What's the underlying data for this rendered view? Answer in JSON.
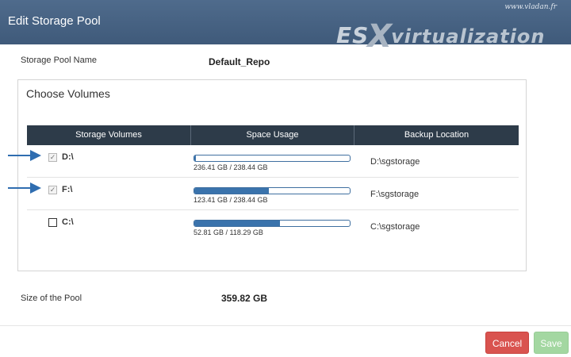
{
  "header": {
    "title": "Edit Storage Pool"
  },
  "logo": {
    "url": "www.vladan.fr",
    "part1": "ES",
    "part2": "X",
    "part3": "virtualization"
  },
  "pool": {
    "name_label": "Storage Pool Name",
    "name_value": "Default_Repo",
    "size_label": "Size of the Pool",
    "size_value": "359.82 GB"
  },
  "volumes": {
    "title": "Choose Volumes",
    "headers": [
      "Storage Volumes",
      "Space Usage",
      "Backup Location"
    ],
    "rows": [
      {
        "checked": true,
        "mark": "✓",
        "volume": "D:\\",
        "usage": "236.41 GB / 238.44 GB",
        "used_fraction": 0.01,
        "location": "D:\\sgstorage",
        "arrow": true
      },
      {
        "checked": true,
        "mark": "✓",
        "volume": "F:\\",
        "usage": "123.41 GB / 238.44 GB",
        "used_fraction": 0.48,
        "location": "F:\\sgstorage",
        "arrow": true
      },
      {
        "checked": false,
        "mark": "",
        "volume": "C:\\",
        "usage": "52.81 GB / 118.29 GB",
        "used_fraction": 0.55,
        "location": "C:\\sgstorage",
        "arrow": false
      }
    ]
  },
  "footer": {
    "cancel_label": "Cancel",
    "save_label": "Save"
  },
  "colors": {
    "header": "#4a6586",
    "table_header": "#2d3b49",
    "bar_fill": "#3a73ac",
    "cancel": "#d9534f",
    "save_disabled": "#a3d7a1",
    "arrow": "#2f6db0"
  }
}
